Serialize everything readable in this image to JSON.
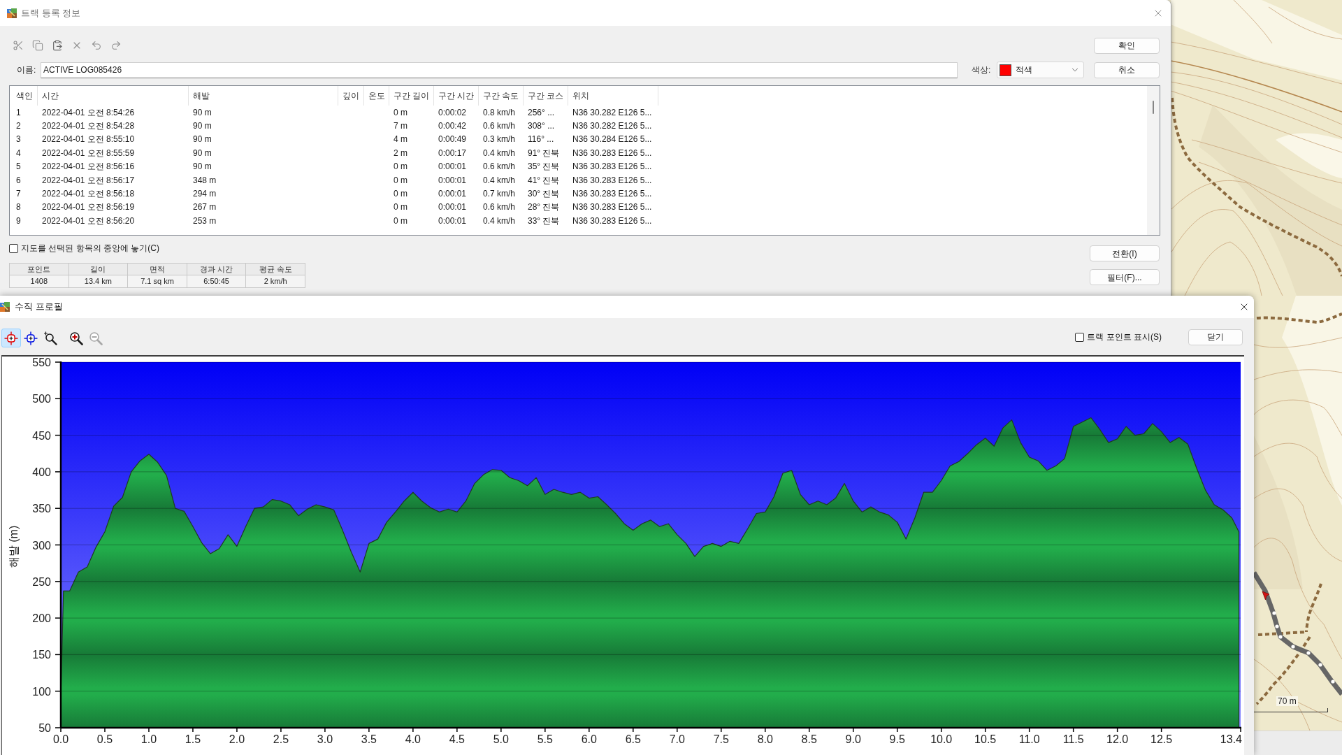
{
  "track_dialog": {
    "title": "트랙 등록 정보",
    "name_label": "이름:",
    "name_value": "ACTIVE LOG085426",
    "color_label": "색상:",
    "color_select": {
      "value": "적색",
      "color": "#ff0000"
    },
    "buttons": [
      "확인",
      "취소"
    ],
    "columns": [
      "색인",
      "시간",
      "해발",
      "깊이",
      "온도",
      "구간 길이",
      "구간 시간",
      "구간 속도",
      "구간 코스",
      "위치"
    ],
    "rows": [
      {
        "index": "1",
        "time": "2022-04-01 오전 8:54:26",
        "elevation": "90 m",
        "leg_length": "0 m",
        "leg_time": "0:00:02",
        "leg_speed": "0.8 km/h",
        "leg_course": "256° ...",
        "position": "N36 30.282 E126 5..."
      },
      {
        "index": "2",
        "time": "2022-04-01 오전 8:54:28",
        "elevation": "90 m",
        "leg_length": "7 m",
        "leg_time": "0:00:42",
        "leg_speed": "0.6 km/h",
        "leg_course": "308° ...",
        "position": "N36 30.282 E126 5..."
      },
      {
        "index": "3",
        "time": "2022-04-01 오전 8:55:10",
        "elevation": "90 m",
        "leg_length": "4 m",
        "leg_time": "0:00:49",
        "leg_speed": "0.3 km/h",
        "leg_course": "116° ...",
        "position": "N36 30.284 E126 5..."
      },
      {
        "index": "4",
        "time": "2022-04-01 오전 8:55:59",
        "elevation": "90 m",
        "leg_length": "2 m",
        "leg_time": "0:00:17",
        "leg_speed": "0.4 km/h",
        "leg_course": "91° 진북",
        "position": "N36 30.283 E126 5..."
      },
      {
        "index": "5",
        "time": "2022-04-01 오전 8:56:16",
        "elevation": "90 m",
        "leg_length": "0 m",
        "leg_time": "0:00:01",
        "leg_speed": "0.6 km/h",
        "leg_course": "35° 진북",
        "position": "N36 30.283 E126 5..."
      },
      {
        "index": "6",
        "time": "2022-04-01 오전 8:56:17",
        "elevation": "348 m",
        "leg_length": "0 m",
        "leg_time": "0:00:01",
        "leg_speed": "0.4 km/h",
        "leg_course": "41° 진북",
        "position": "N36 30.283 E126 5..."
      },
      {
        "index": "7",
        "time": "2022-04-01 오전 8:56:18",
        "elevation": "294 m",
        "leg_length": "0 m",
        "leg_time": "0:00:01",
        "leg_speed": "0.7 km/h",
        "leg_course": "30° 진북",
        "position": "N36 30.283 E126 5..."
      },
      {
        "index": "8",
        "time": "2022-04-01 오전 8:56:19",
        "elevation": "267 m",
        "leg_length": "0 m",
        "leg_time": "0:00:01",
        "leg_speed": "0.6 km/h",
        "leg_course": "28° 진북",
        "position": "N36 30.283 E126 5..."
      },
      {
        "index": "9",
        "time": "2022-04-01 오전 8:56:20",
        "elevation": "253 m",
        "leg_length": "0 m",
        "leg_time": "0:00:01",
        "leg_speed": "0.4 km/h",
        "leg_course": "33° 진북",
        "position": "N36 30.283 E126 5..."
      }
    ],
    "center_on_map": {
      "label": "지도를 선택된 항목의 중앙에 놓기(C)",
      "checked": false
    },
    "summary": [
      {
        "label": "포인트",
        "value": "1408"
      },
      {
        "label": "길이",
        "value": "13.4 km"
      },
      {
        "label": "면적",
        "value": "7.1 sq km"
      },
      {
        "label": "경과 시간",
        "value": "6:50:45"
      },
      {
        "label": "평균 속도",
        "value": "2 km/h"
      }
    ],
    "side_buttons": [
      "전환(I)",
      "필터(F)..."
    ]
  },
  "profile_window": {
    "title": "수직 프로필",
    "tools": [
      {
        "kind": "pointer",
        "selected": true,
        "disabled": false
      },
      {
        "kind": "marker",
        "selected": false,
        "disabled": false
      },
      {
        "kind": "zoombox",
        "selected": false,
        "disabled": false
      },
      {
        "kind": "zoomin",
        "selected": false,
        "disabled": false
      },
      {
        "kind": "zoomout",
        "selected": false,
        "disabled": true
      }
    ],
    "show_points": {
      "label": "트랙 포인트 표시(S)",
      "checked": false
    },
    "close_button": "닫기",
    "chart_data": {
      "type": "area",
      "ylabel": "해발 (m)",
      "grid": true,
      "x": [
        0,
        0.03,
        0.1,
        0.2,
        0.3,
        0.4,
        0.5,
        0.6,
        0.7,
        0.8,
        0.9,
        1.0,
        1.1,
        1.2,
        1.3,
        1.4,
        1.5,
        1.6,
        1.7,
        1.8,
        1.9,
        2.0,
        2.1,
        2.2,
        2.3,
        2.4,
        2.5,
        2.6,
        2.7,
        2.8,
        2.9,
        3.0,
        3.1,
        3.2,
        3.3,
        3.4,
        3.5,
        3.6,
        3.7,
        3.8,
        3.9,
        4.0,
        4.1,
        4.2,
        4.3,
        4.4,
        4.5,
        4.6,
        4.7,
        4.8,
        4.9,
        5.0,
        5.1,
        5.2,
        5.3,
        5.4,
        5.5,
        5.6,
        5.7,
        5.8,
        5.9,
        6.0,
        6.1,
        6.2,
        6.3,
        6.4,
        6.5,
        6.6,
        6.7,
        6.8,
        6.9,
        7.0,
        7.1,
        7.2,
        7.3,
        7.4,
        7.5,
        7.6,
        7.7,
        7.8,
        7.9,
        8.0,
        8.1,
        8.2,
        8.3,
        8.4,
        8.5,
        8.6,
        8.7,
        8.8,
        8.9,
        9.0,
        9.1,
        9.2,
        9.3,
        9.4,
        9.5,
        9.6,
        9.7,
        9.8,
        9.9,
        10.0,
        10.1,
        10.2,
        10.3,
        10.4,
        10.5,
        10.6,
        10.7,
        10.8,
        10.9,
        11.0,
        11.1,
        11.2,
        11.3,
        11.4,
        11.5,
        11.6,
        11.7,
        11.8,
        11.9,
        12.0,
        12.1,
        12.2,
        12.3,
        12.4,
        12.5,
        12.6,
        12.7,
        12.8,
        12.9,
        13.0,
        13.1,
        13.2,
        13.3,
        13.38
      ],
      "values": [
        90,
        237,
        237,
        263,
        270,
        297,
        318,
        353,
        365,
        400,
        415,
        424,
        413,
        395,
        350,
        346,
        325,
        303,
        288,
        295,
        314,
        298,
        325,
        350,
        352,
        362,
        360,
        355,
        340,
        349,
        355,
        352,
        348,
        320,
        290,
        263,
        302,
        308,
        331,
        345,
        360,
        372,
        360,
        351,
        345,
        349,
        345,
        360,
        384,
        396,
        403,
        402,
        392,
        388,
        381,
        392,
        369,
        376,
        372,
        369,
        372,
        364,
        366,
        355,
        343,
        329,
        320,
        329,
        334,
        325,
        329,
        314,
        302,
        284,
        298,
        302,
        298,
        305,
        302,
        322,
        343,
        345,
        366,
        398,
        402,
        369,
        355,
        360,
        355,
        364,
        384,
        360,
        345,
        352,
        345,
        341,
        331,
        308,
        337,
        372,
        372,
        388,
        408,
        414,
        425,
        437,
        446,
        435,
        460,
        471,
        440,
        420,
        415,
        402,
        408,
        418,
        462,
        468,
        474,
        458,
        440,
        445,
        462,
        450,
        452,
        466,
        455,
        440,
        447,
        438,
        405,
        375,
        355,
        348,
        337,
        318
      ],
      "xlim": [
        0,
        13.4
      ],
      "ylim": [
        50,
        550
      ],
      "xticks": [
        {
          "value": 0,
          "label": "0.0"
        },
        {
          "value": 0.5,
          "label": "0.5"
        },
        {
          "value": 1,
          "label": "1.0"
        },
        {
          "value": 1.5,
          "label": "1.5"
        },
        {
          "value": 2,
          "label": "2.0"
        },
        {
          "value": 2.5,
          "label": "2.5"
        },
        {
          "value": 3,
          "label": "3.0"
        },
        {
          "value": 3.5,
          "label": "3.5"
        },
        {
          "value": 4,
          "label": "4.0"
        },
        {
          "value": 4.5,
          "label": "4.5"
        },
        {
          "value": 5,
          "label": "5.0"
        },
        {
          "value": 5.5,
          "label": "5.5"
        },
        {
          "value": 6,
          "label": "6.0"
        },
        {
          "value": 6.5,
          "label": "6.5"
        },
        {
          "value": 7,
          "label": "7.0"
        },
        {
          "value": 7.5,
          "label": "7.5"
        },
        {
          "value": 8,
          "label": "8.0"
        },
        {
          "value": 8.5,
          "label": "8.5"
        },
        {
          "value": 9,
          "label": "9.0"
        },
        {
          "value": 9.5,
          "label": "9.5"
        },
        {
          "value": 10,
          "label": "10.0"
        },
        {
          "value": 10.5,
          "label": "10.5"
        },
        {
          "value": 11,
          "label": "11.0"
        },
        {
          "value": 11.5,
          "label": "11.5"
        },
        {
          "value": 12,
          "label": "12.0"
        },
        {
          "value": 12.5,
          "label": "12.5"
        },
        {
          "value": 13.4,
          "label": "13.4"
        }
      ],
      "yticks": [
        50,
        100,
        150,
        200,
        250,
        300,
        350,
        400,
        450,
        500,
        550
      ]
    }
  },
  "map": {
    "scale_label": "70 m"
  }
}
